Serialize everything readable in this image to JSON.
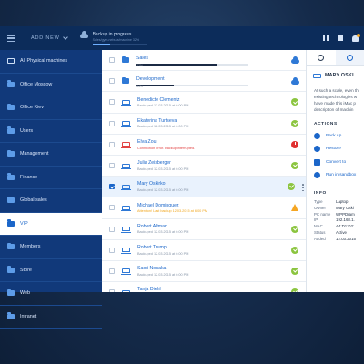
{
  "topbar": {
    "add_new": "ADD NEW",
    "progress_title": "Backup in progress",
    "progress_sub": "Sales/gym-nebula/machine 32%",
    "progress_value": 0.32
  },
  "sidebar": {
    "items": [
      {
        "label": "All Physical machines",
        "icon": "screen-icon"
      },
      {
        "label": "Office Moscow",
        "icon": "folder-icon"
      },
      {
        "label": "Office Kiev",
        "icon": "folder-icon"
      },
      {
        "label": "Users",
        "icon": "folder-icon"
      },
      {
        "label": "Management",
        "icon": "folder-icon"
      },
      {
        "label": "Finance",
        "icon": "folder-icon"
      },
      {
        "label": "Global sales",
        "icon": "folder-icon"
      },
      {
        "label": "VIP",
        "icon": "folder-icon",
        "active": true
      },
      {
        "label": "Members",
        "icon": "folder-icon"
      },
      {
        "label": "Store",
        "icon": "folder-icon"
      },
      {
        "label": "Web",
        "icon": "folder-icon"
      },
      {
        "label": "Intranet",
        "icon": "folder-icon"
      }
    ]
  },
  "list": {
    "rows": [
      {
        "name": "Sales",
        "type": "folder",
        "progress": 0.72,
        "pct": "72%",
        "status": "cloud"
      },
      {
        "name": "Development",
        "type": "folder",
        "progress": 0.34,
        "pct": "34%",
        "status": "cloud"
      },
      {
        "name": "Benedicte Clementz",
        "sub": "Backuped 12.03.2015 at 6:00 PM",
        "status": "ok"
      },
      {
        "name": "Ekaterina Turtseva",
        "sub": "Backuped 12.03.2015 at 6:00 PM",
        "status": "ok"
      },
      {
        "name": "Elva Zou",
        "sub": "Connection error. Backup interrupted.",
        "sub_style": "err",
        "status": "err"
      },
      {
        "name": "Julia Zeisberger",
        "sub": "Backuped 12.03.2015 at 6:00 PM",
        "status": "ok"
      },
      {
        "name": "Mary Oskirko",
        "sub": "Backuped 12.03.2015 at 6:00 PM",
        "status": "ok",
        "selected": true
      },
      {
        "name": "Michael Dominguez",
        "sub": "Attention! Last backup 12.03.2015 at 6:00 PM",
        "sub_style": "warn",
        "status": "warn"
      },
      {
        "name": "Robert Altman",
        "sub": "Backuped 12.03.2015 at 6:00 PM",
        "status": "ok"
      },
      {
        "name": "Robert Trump",
        "sub": "Backuped 12.03.2015 at 6:00 PM",
        "status": "ok"
      },
      {
        "name": "Saori Nonaka",
        "sub": "Backuped 12.03.2015 at 6:00 PM",
        "status": "ok"
      },
      {
        "name": "Tanja Diehl",
        "sub": "Backuped 12.03.2015 at 6:00 PM",
        "status": "ok"
      }
    ]
  },
  "panel": {
    "name": "MARY OSKI",
    "desc_lines": [
      "At such a scale, even th",
      "existing technologies w",
      "have made this iMac p",
      "description of machin"
    ],
    "actions_title": "ACTIONS",
    "actions": [
      "Back up",
      "Restore",
      "Convert to",
      "Run in sandbox"
    ],
    "info_title": "INFO",
    "info": [
      {
        "k": "Type",
        "v": "Laptop"
      },
      {
        "k": "Owner",
        "v": "Mary Oski"
      },
      {
        "k": "PC name",
        "v": "WPPDram"
      },
      {
        "k": "IP",
        "v": "192.168.1."
      },
      {
        "k": "MAC",
        "v": "A4:D1:D2:"
      },
      {
        "k": "Status",
        "v": "Active"
      },
      {
        "k": "Added",
        "v": "12.03.2015"
      }
    ]
  },
  "colors": {
    "accent": "#1b66c9",
    "sidebar_bg": "#11397a",
    "topbar_bg": "#0c2c5a",
    "ok": "#8cc540",
    "error": "#e02f2f",
    "warning": "#f5a623"
  }
}
